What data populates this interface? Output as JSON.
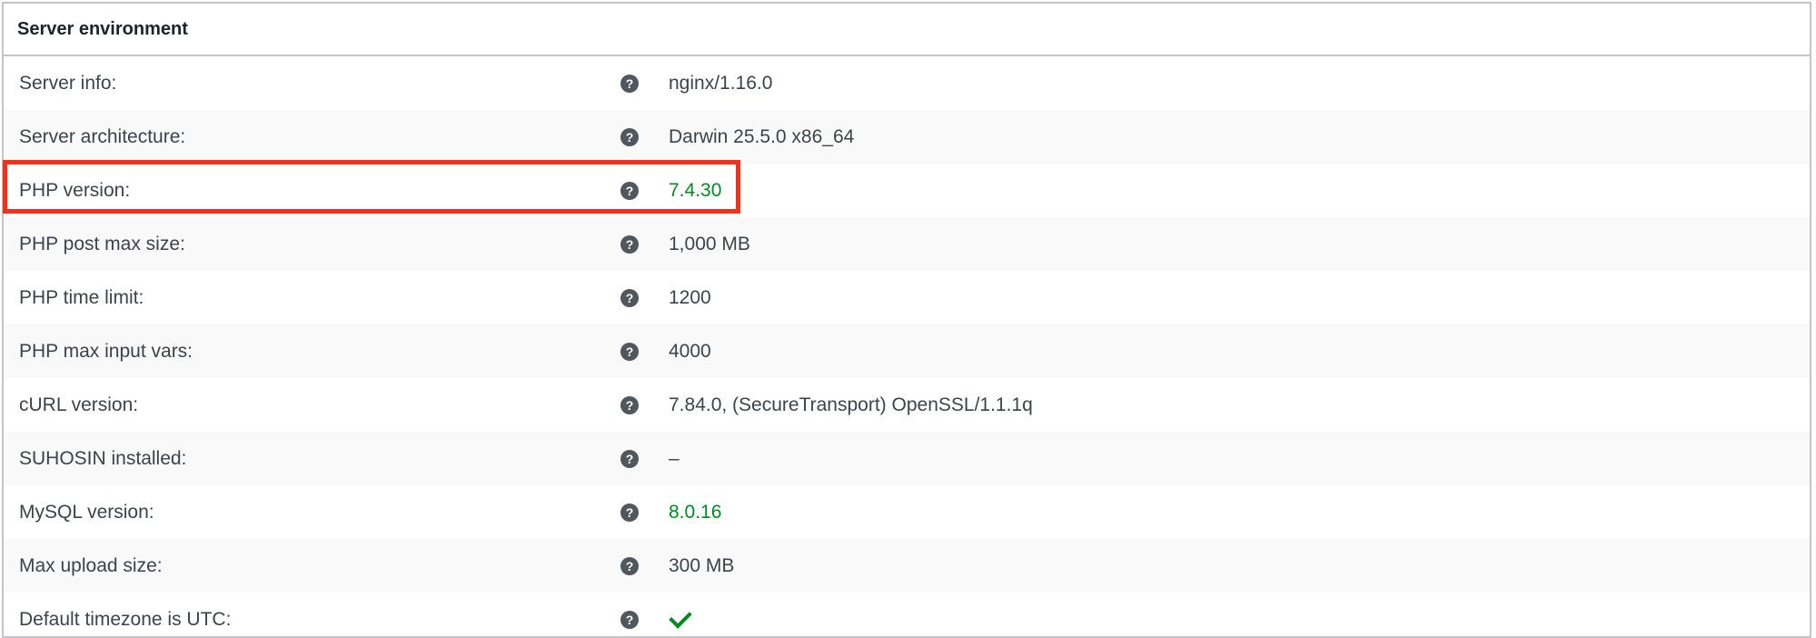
{
  "section_title": "Server environment",
  "rows": [
    {
      "label": "Server info:",
      "value": "nginx/1.16.0",
      "status": "normal"
    },
    {
      "label": "Server architecture:",
      "value": "Darwin 25.5.0 x86_64",
      "status": "normal"
    },
    {
      "label": "PHP version:",
      "value": "7.4.30",
      "status": "good"
    },
    {
      "label": "PHP post max size:",
      "value": "1,000 MB",
      "status": "normal"
    },
    {
      "label": "PHP time limit:",
      "value": "1200",
      "status": "normal"
    },
    {
      "label": "PHP max input vars:",
      "value": "4000",
      "status": "normal"
    },
    {
      "label": "cURL version:",
      "value": "7.84.0, (SecureTransport) OpenSSL/1.1.1q",
      "status": "normal"
    },
    {
      "label": "SUHOSIN installed:",
      "value": "–",
      "status": "normal"
    },
    {
      "label": "MySQL version:",
      "value": "8.0.16",
      "status": "good"
    },
    {
      "label": "Max upload size:",
      "value": "300 MB",
      "status": "normal"
    },
    {
      "label": "Default timezone is UTC:",
      "value": "",
      "status": "check"
    }
  ],
  "help_icon": "question-circle-icon",
  "help_glyph": "?",
  "colors": {
    "good": "#008a20",
    "highlight": "#f2311d",
    "help_icon_bg": "#50575e"
  }
}
